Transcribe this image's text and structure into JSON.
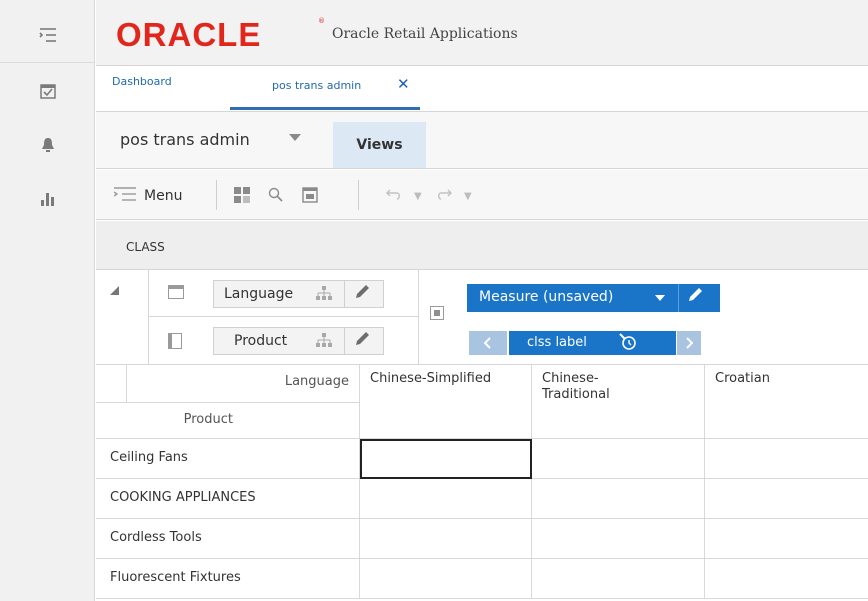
{
  "app": {
    "brand": "ORACLE",
    "brand_mark": "®",
    "title": "Oracle Retail Applications",
    "brand_color": "#e1261c",
    "accent_color": "#1a74c7"
  },
  "rail": {
    "items": [
      {
        "icon": "task-list-icon"
      },
      {
        "icon": "calendar-check-icon"
      },
      {
        "icon": "notification-bell-icon"
      },
      {
        "icon": "bar-chart-icon"
      }
    ]
  },
  "tabs": {
    "items": [
      {
        "label": "Dashboard"
      },
      {
        "label": "pos trans admin"
      }
    ],
    "close_glyph": "✕"
  },
  "view": {
    "name": "pos trans admin",
    "views_label": "Views"
  },
  "toolbar": {
    "menu_label": "Menu"
  },
  "panel": {
    "title": "CLASS"
  },
  "pivot": {
    "row_dimension": "Language",
    "column_dimension": "Product",
    "measure_label": "Measure (unsaved)",
    "measure_value": "clss label"
  },
  "grid": {
    "corner_top": "Language",
    "corner_bottom": "Product",
    "columns": [
      "Chinese-Simplified",
      "Chinese-Traditional",
      "Croatian"
    ],
    "rows": [
      "Ceiling Fans",
      "COOKING APPLIANCES",
      "Cordless Tools",
      "Fluorescent Fixtures"
    ]
  }
}
